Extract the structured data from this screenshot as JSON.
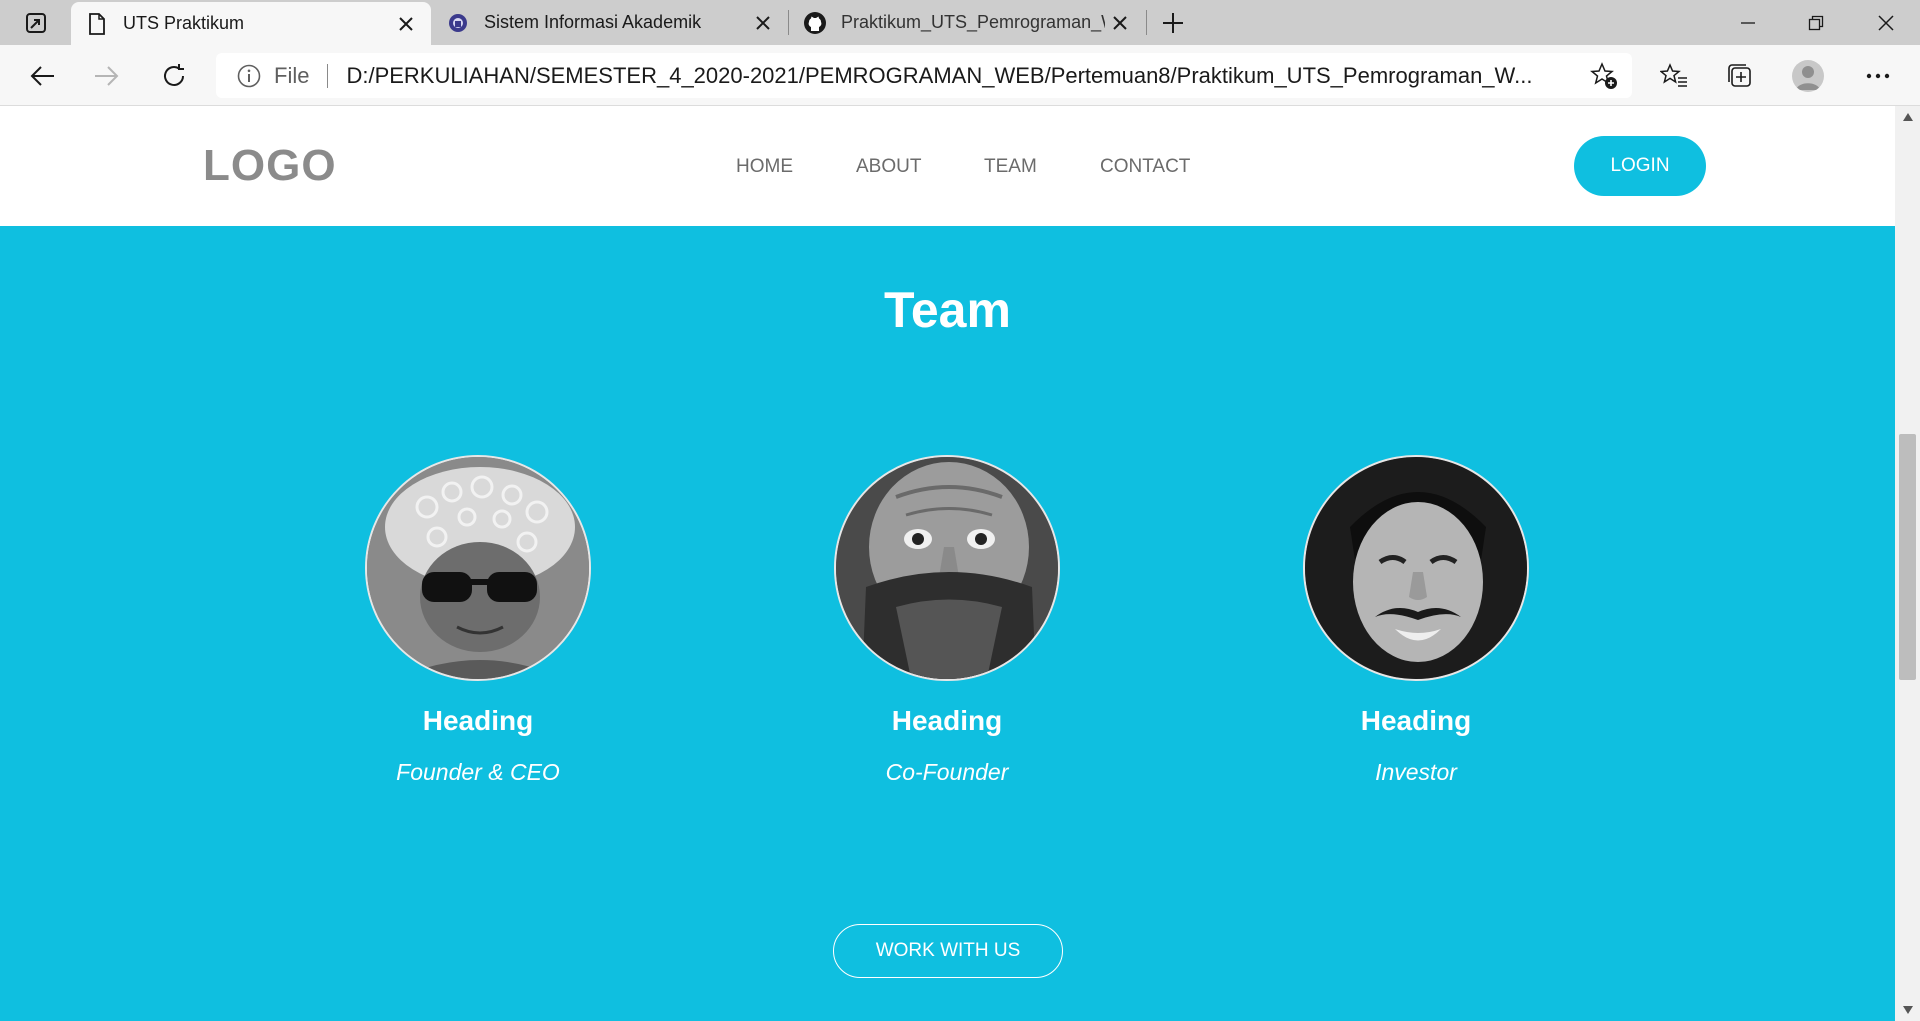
{
  "browser": {
    "tabs": [
      {
        "title": "UTS Praktikum",
        "icon": "page-icon",
        "active": true
      },
      {
        "title": "Sistem Informasi Akademik",
        "icon": "university-crest-icon",
        "active": false
      },
      {
        "title": "Praktikum_UTS_Pemrograman_W",
        "icon": "github-icon",
        "active": false
      }
    ],
    "address": {
      "scheme_label": "File",
      "url": "D:/PERKULIAHAN/SEMESTER_4_2020-2021/PEMROGRAMAN_WEB/Pertemuan8/Praktikum_UTS_Pemrograman_W..."
    }
  },
  "site": {
    "logo": "LOGO",
    "nav": [
      "HOME",
      "ABOUT",
      "TEAM",
      "CONTACT"
    ],
    "login_label": "LOGIN",
    "accent_color": "#0fbfe0"
  },
  "team": {
    "title": "Team",
    "members": [
      {
        "heading": "Heading",
        "role": "Founder & CEO"
      },
      {
        "heading": "Heading",
        "role": "Co-Founder"
      },
      {
        "heading": "Heading",
        "role": "Investor"
      }
    ],
    "cta_label": "WORK WITH US"
  }
}
